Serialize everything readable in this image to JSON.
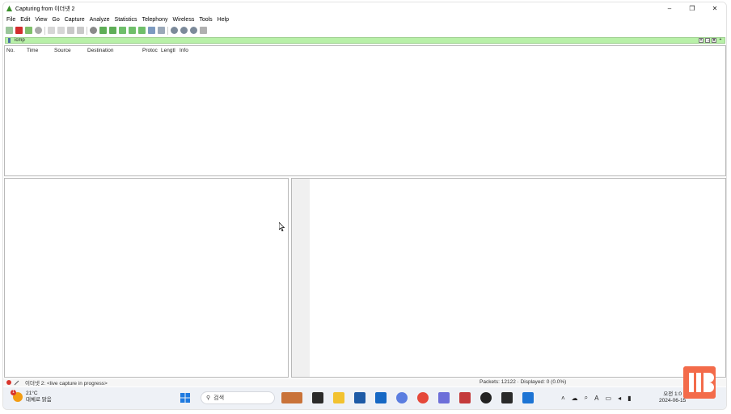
{
  "window": {
    "title": "Capturing from 이더넷 2",
    "controls": {
      "minimize": "–",
      "maximize": "❐",
      "close": "✕"
    }
  },
  "menu": [
    "File",
    "Edit",
    "View",
    "Go",
    "Capture",
    "Analyze",
    "Statistics",
    "Telephony",
    "Wireless",
    "Tools",
    "Help"
  ],
  "filter": {
    "value": "icmp"
  },
  "packet_list": {
    "columns": [
      "No.",
      "Time",
      "Source",
      "Destination",
      "Protoc",
      "Lengtl",
      "Info"
    ]
  },
  "status": {
    "left": "이더넷 2: <live capture in progress>",
    "right": "Packets: 12122 · Displayed: 0 (0.0%)"
  },
  "taskbar": {
    "weather_badge": "1",
    "weather_temp": "21°C",
    "weather_desc": "대체로 맑음",
    "search_placeholder": "검색",
    "tray_ime": "A",
    "clock_time": "오전 1:0",
    "clock_date": "2024-06-15"
  },
  "colors": {
    "filter_bg": "#b8f0a8",
    "accent": "#3a8f2a",
    "stop_red": "#d22d2d"
  }
}
